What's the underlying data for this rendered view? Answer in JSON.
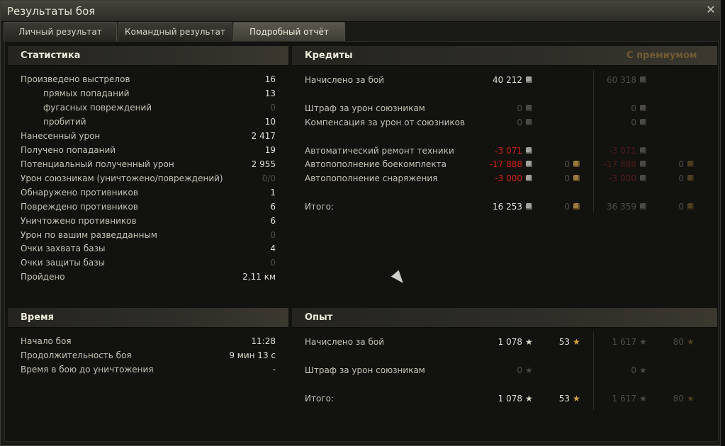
{
  "window": {
    "title": "Результаты боя",
    "close_glyph": "✕"
  },
  "tabs": [
    {
      "label": "Личный результат"
    },
    {
      "label": "Командный результат"
    },
    {
      "label": "Подробный отчёт"
    }
  ],
  "stats": {
    "title": "Статистика",
    "rows": [
      {
        "label": "Произведено выстрелов",
        "value": "16"
      },
      {
        "label": "прямых попаданий",
        "value": "13"
      },
      {
        "label": "фугасных повреждений",
        "value": "0"
      },
      {
        "label": "пробитий",
        "value": "10"
      },
      {
        "label": "Нанесенный урон",
        "value": "2 417"
      },
      {
        "label": "Получено попаданий",
        "value": "19"
      },
      {
        "label": "Потенциальный полученный урон",
        "value": "2 955"
      },
      {
        "label": "Урон союзникам (уничтожено/повреждений)",
        "value": "0/0"
      },
      {
        "label": "Обнаружено противников",
        "value": "1"
      },
      {
        "label": "Повреждено противников",
        "value": "6"
      },
      {
        "label": "Уничтожено противников",
        "value": "6"
      },
      {
        "label": "Урон по вашим разведданным",
        "value": "0"
      },
      {
        "label": "Очки захвата базы",
        "value": "4"
      },
      {
        "label": "Очки защиты базы",
        "value": "0"
      },
      {
        "label": "Пройдено",
        "value": "2,11 км"
      }
    ]
  },
  "time": {
    "title": "Время",
    "rows": [
      {
        "label": "Начало боя",
        "value": "11:28"
      },
      {
        "label": "Продолжительность боя",
        "value": "9 мин 13 с"
      },
      {
        "label": "Время в бою до уничтожения",
        "value": "-"
      }
    ]
  },
  "credits": {
    "title": "Кредиты",
    "premium_title": "С премиумом",
    "rows": [
      {
        "label": "Начислено за бой",
        "base": "40 212",
        "premium": "60 318"
      },
      {
        "label": "Штраф за урон союзникам",
        "base": "0",
        "premium": "0"
      },
      {
        "label": "Компенсация за урон от союзников",
        "base": "0",
        "premium": "0"
      },
      {
        "label": "Автоматический ремонт техники",
        "base": "-3 071",
        "premium": "-3 071"
      },
      {
        "label": "Автопополнение боекомплекта",
        "base": "-17 888",
        "base_gold": "0",
        "premium": "-17 888",
        "premium_gold": "0"
      },
      {
        "label": "Автопополнение снаряжения",
        "base": "-3 000",
        "base_gold": "0",
        "premium": "-3 000",
        "premium_gold": "0"
      },
      {
        "label": "Итого:",
        "base": "16 253",
        "base_gold": "0",
        "premium": "36 359",
        "premium_gold": "0"
      }
    ]
  },
  "experience": {
    "title": "Опыт",
    "rows": [
      {
        "label": "Начислено за бой",
        "base": "1 078",
        "free": "53",
        "premium": "1 617",
        "premium_free": "80"
      },
      {
        "label": "Штраф за урон союзникам",
        "base": "0",
        "premium": "0"
      },
      {
        "label": "Итого:",
        "base": "1 078",
        "free": "53",
        "premium": "1 617",
        "premium_free": "80"
      }
    ]
  },
  "icons": {
    "silver": "credits-icon",
    "gold": "gold-icon",
    "star": "★"
  },
  "colors": {
    "negative": "#d0221b",
    "premium_header": "#6f5a33",
    "gold_star": "#d7a445"
  }
}
